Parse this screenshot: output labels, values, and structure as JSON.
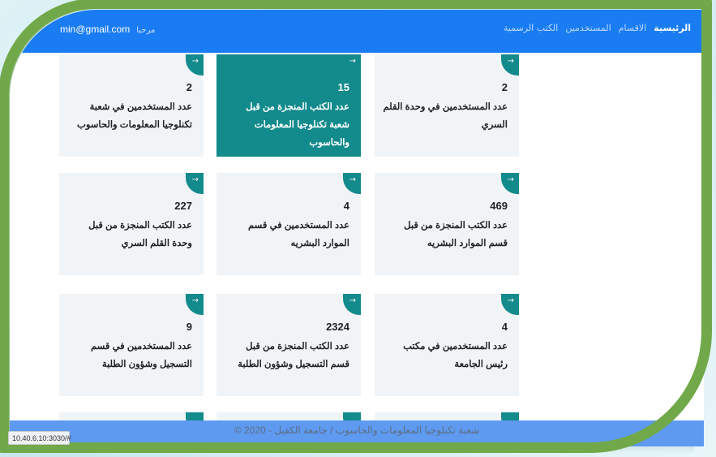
{
  "navbar": {
    "links": [
      "الرئيسية",
      "الاقسام",
      "المستخدمين",
      "الكتب الرسمية"
    ],
    "greeting": "مرحبا",
    "email": "min@gmail.com"
  },
  "cards": [
    {
      "number": "2",
      "label": "عدد المستخدمين في وحدة القلم السري"
    },
    {
      "number": "15",
      "label": "عدد الكتب المنجزة من قبل شعبة تكنلوجيا المعلومات والحاسوب"
    },
    {
      "number": "2",
      "label": "عدد المستخدمين في شعبة تكنلوجيا المعلومات والحاسوب"
    },
    {
      "number": "469",
      "label": "عدد الكتب المنجزة من قبل قسم الموارد البشريه"
    },
    {
      "number": "4",
      "label": "عدد المستخدمين في قسم الموارد البشريه"
    },
    {
      "number": "227",
      "label": "عدد الكتب المنجزة من قبل وحدة القلم السري"
    },
    {
      "number": "4",
      "label": "عدد المستخدمين في مكتب رئيس الجامعة"
    },
    {
      "number": "2324",
      "label": "عدد الكتب المنجزة من قبل قسم التسجيل وشؤون الطلبة"
    },
    {
      "number": "9",
      "label": "عدد المستخدمين في قسم التسجيل وشؤون الطلبة"
    }
  ],
  "card_arrow": "→",
  "footer": {
    "text": "شعبة تكنلوجيا المعلومات والحاسوب / جامعة الكفيل - 2020 ©"
  },
  "status_url": "10.40.6.10:3030/#",
  "colors": {
    "navbar": "#1a7cf2",
    "accent": "#138a8c",
    "frame": "#71a94a"
  }
}
